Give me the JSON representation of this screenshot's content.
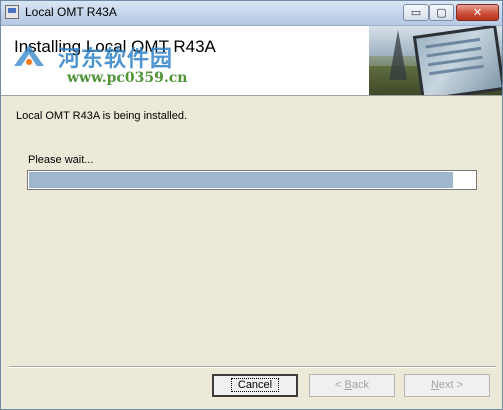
{
  "window": {
    "title": "Local OMT R43A",
    "controls": {
      "minimize": "▭",
      "maximize": "▢",
      "close": "✕"
    }
  },
  "header": {
    "title": "Installing Local OMT R43A",
    "image": "satellite-tablet-photo"
  },
  "watermark": {
    "text": "河东软件园",
    "url": "www.pc0359.cn"
  },
  "content": {
    "status": "Local OMT R43A is being installed.",
    "wait": "Please wait...",
    "progress": 0.95
  },
  "buttons": {
    "cancel": "Cancel",
    "back_prefix": "< ",
    "back_key": "B",
    "back_rest": "ack",
    "next_key": "N",
    "next_rest": "ext >"
  },
  "colors": {
    "progress_fill": "#9fb6cf",
    "watermark_blue": "#2f82c9",
    "watermark_green": "#3b8a24"
  }
}
